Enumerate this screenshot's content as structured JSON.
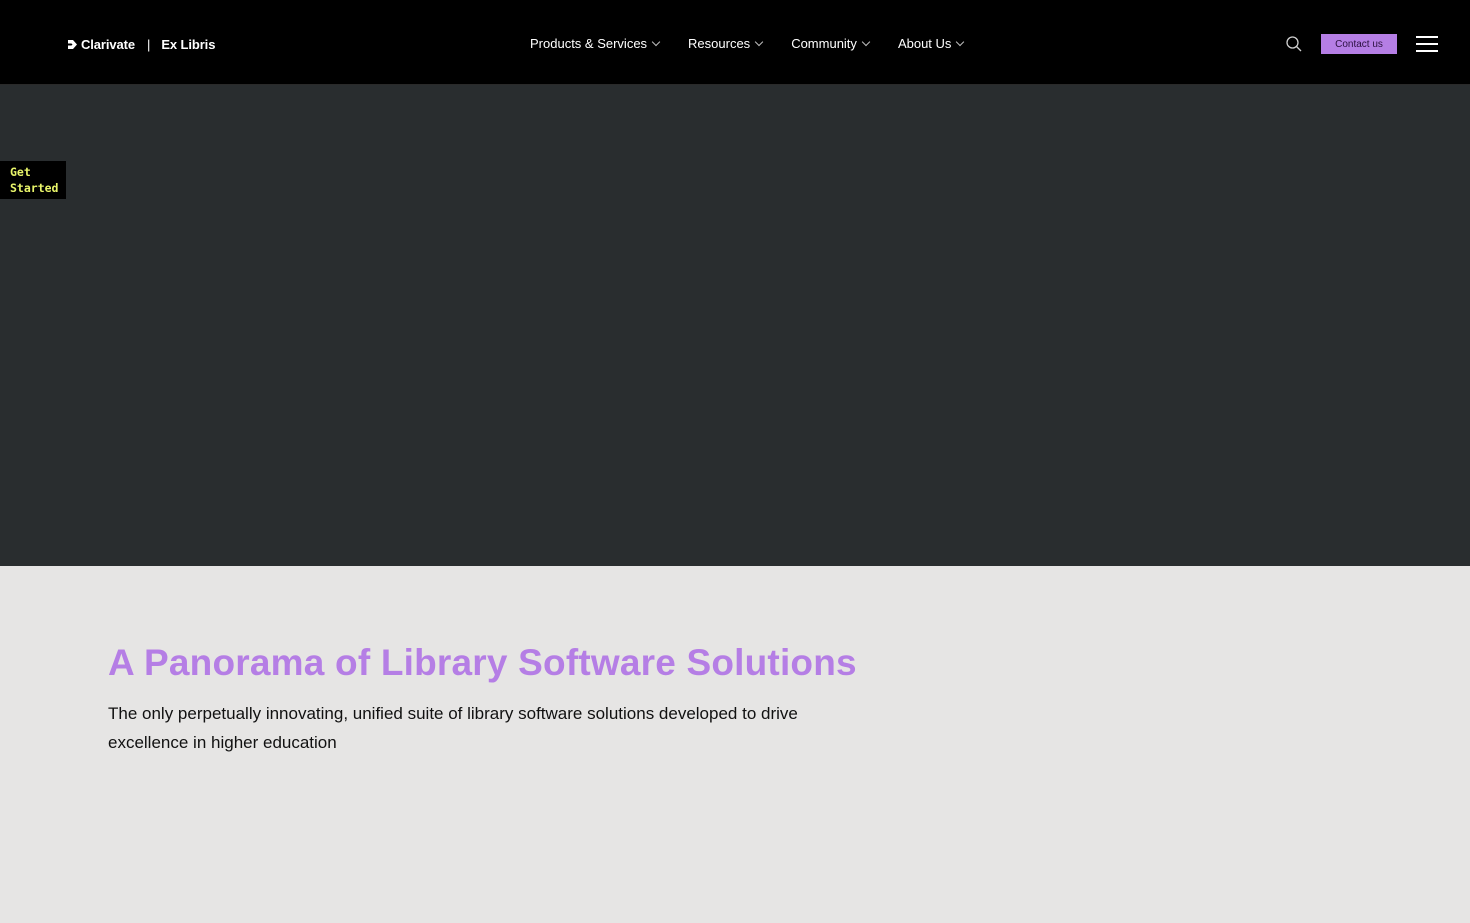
{
  "header": {
    "logo": {
      "brand": "Clarivate",
      "separator": "|",
      "product": "Ex Libris"
    },
    "nav": [
      {
        "label": "Products & Services",
        "icon": "chevron-down-icon"
      },
      {
        "label": "Resources",
        "icon": "chevron-down-icon"
      },
      {
        "label": "Community",
        "icon": "chevron-down-icon"
      },
      {
        "label": "About Us",
        "icon": "chevron-down-icon"
      }
    ],
    "search_icon": "search-icon",
    "contact_label": "Contact us",
    "menu_icon": "hamburger-menu-icon"
  },
  "hero": {
    "get_started_label": "Get\nStarted"
  },
  "content": {
    "headline": "A Panorama of Library Software Solutions",
    "subhead": "The only perpetually innovating, unified suite of library software solutions developed to drive excellence in higher education"
  },
  "colors": {
    "header_bg": "#000000",
    "hero_bg": "#292d2f",
    "accent_purple": "#b57ee5",
    "get_started_text": "#e9f56a",
    "content_bg": "#e6e5e4"
  }
}
